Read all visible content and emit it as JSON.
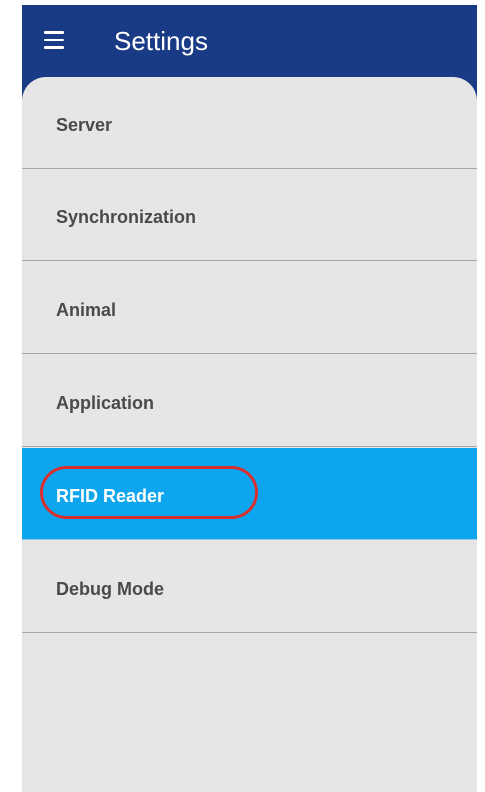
{
  "header": {
    "title": "Settings",
    "menu_icon": "hamburger-menu-icon"
  },
  "settings": {
    "items": [
      {
        "label": "Server",
        "selected": false
      },
      {
        "label": "Synchronization",
        "selected": false
      },
      {
        "label": "Animal",
        "selected": false
      },
      {
        "label": "Application",
        "selected": false
      },
      {
        "label": "RFID Reader",
        "selected": true
      },
      {
        "label": "Debug Mode",
        "selected": false
      }
    ]
  },
  "colors": {
    "appbar": "#193b85",
    "panel": "#e6e6e6",
    "selected": "#0ea5ef",
    "highlight_ring": "#d8302e",
    "label": "#4a4a4a"
  }
}
